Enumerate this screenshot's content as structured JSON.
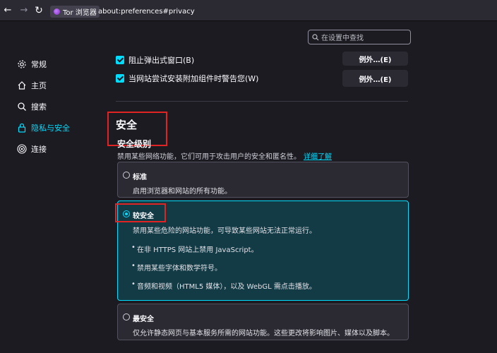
{
  "toolbar": {
    "identity_label": "Tor 浏览器",
    "url": "about:preferences#privacy"
  },
  "search": {
    "placeholder": "在设置中查找"
  },
  "sidebar": {
    "items": [
      {
        "label": "常规",
        "icon": "gear-icon"
      },
      {
        "label": "主页",
        "icon": "home-icon"
      },
      {
        "label": "搜索",
        "icon": "search-icon"
      },
      {
        "label": "隐私与安全",
        "icon": "lock-icon",
        "active": true
      },
      {
        "label": "连接",
        "icon": "connection-icon"
      }
    ]
  },
  "permissions": {
    "popup_label": "阻止弹出式窗口(B)",
    "addons_label": "当网站尝试安装附加组件时警告您(W)",
    "exceptions_label": "例外…(E)"
  },
  "security": {
    "title": "安全",
    "level_title": "安全级别",
    "level_desc": "禁用某些网络功能，它们可用于攻击用户的安全和匿名性。",
    "learn_more": "详细了解",
    "options": [
      {
        "title": "标准",
        "desc": "启用浏览器和网站的所有功能。",
        "selected": false
      },
      {
        "title": "较安全",
        "desc": "禁用某些危险的网站功能，可导致某些网站无法正常运行。",
        "selected": true,
        "bullets": [
          "在非 HTTPS 网站上禁用 JavaScript。",
          "禁用某些字体和数学符号。",
          "音频和视频（HTML5 媒体），以及 WebGL 需点击播放。"
        ]
      },
      {
        "title": "最安全",
        "desc": "仅允许静态网页与基本服务所需的网站功能。这些更改将影响图片、媒体以及脚本。",
        "selected": false
      }
    ]
  },
  "colors": {
    "accent": "#00ddff",
    "highlight": "#e02424",
    "background": "#1c1b22"
  }
}
